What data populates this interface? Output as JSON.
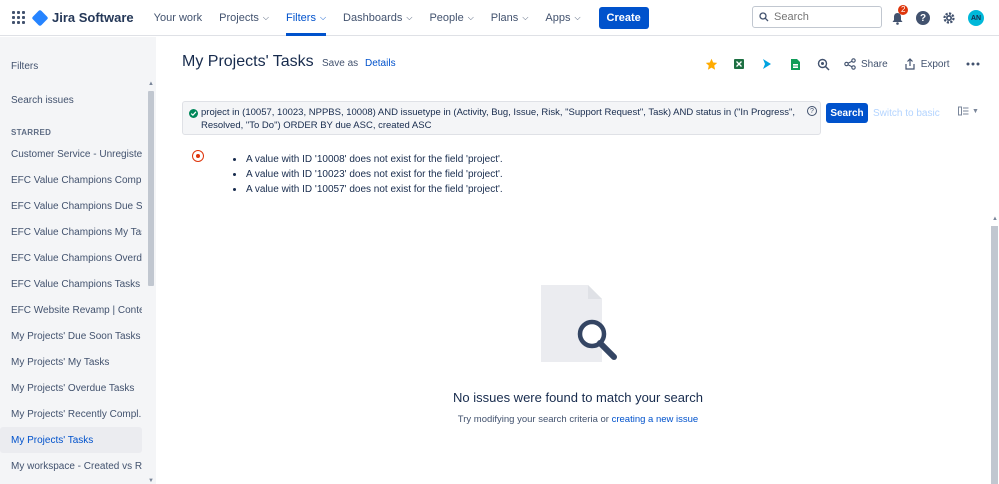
{
  "app": {
    "name": "Jira Software"
  },
  "nav": {
    "items": [
      {
        "label": "Your work",
        "dropdown": false,
        "active": false
      },
      {
        "label": "Projects",
        "dropdown": true,
        "active": false
      },
      {
        "label": "Filters",
        "dropdown": true,
        "active": true
      },
      {
        "label": "Dashboards",
        "dropdown": true,
        "active": false
      },
      {
        "label": "People",
        "dropdown": true,
        "active": false
      },
      {
        "label": "Plans",
        "dropdown": true,
        "active": false
      },
      {
        "label": "Apps",
        "dropdown": true,
        "active": false
      }
    ],
    "create_label": "Create",
    "search_placeholder": "Search",
    "notification_count": "2",
    "avatar_initials": "AN"
  },
  "sidebar": {
    "title": "Filters",
    "search_label": "Search issues",
    "starred_heading": "STARRED",
    "items": [
      {
        "label": "Customer Service - Unregiste...",
        "selected": false
      },
      {
        "label": "EFC Value Champions Compl...",
        "selected": false
      },
      {
        "label": "EFC Value Champions Due S...",
        "selected": false
      },
      {
        "label": "EFC Value Champions My Tas...",
        "selected": false
      },
      {
        "label": "EFC Value Champions Overd...",
        "selected": false
      },
      {
        "label": "EFC Value Champions Tasks",
        "selected": false
      },
      {
        "label": "EFC Website Revamp | Conte...",
        "selected": false
      },
      {
        "label": "My Projects' Due Soon Tasks",
        "selected": false
      },
      {
        "label": "My Projects' My Tasks",
        "selected": false
      },
      {
        "label": "My Projects' Overdue Tasks",
        "selected": false
      },
      {
        "label": "My Projects' Recently Compl...",
        "selected": false
      },
      {
        "label": "My Projects' Tasks",
        "selected": true
      },
      {
        "label": "My workspace - Created vs R...",
        "selected": false
      }
    ]
  },
  "main": {
    "title": "My Projects' Tasks",
    "save_as": "Save as",
    "details": "Details",
    "share_label": "Share",
    "export_label": "Export",
    "jql": "project in (10057, 10023, NPPBS, 10008) AND issuetype in (Activity, Bug, Issue, Risk, \"Support Request\", Task) AND status in (\"In Progress\", Resolved, \"To Do\") ORDER BY due ASC, created ASC",
    "search_button": "Search",
    "switch_basic": "Switch to basic",
    "errors": [
      "A value with ID '10008' does not exist for the field 'project'.",
      "A value with ID '10023' does not exist for the field 'project'.",
      "A value with ID '10057' does not exist for the field 'project'."
    ],
    "empty_title": "No issues were found to match your search",
    "empty_sub_prefix": "Try modifying your search criteria or",
    "empty_sub_link": "creating a new issue"
  },
  "colors": {
    "brand": "#0052cc",
    "error": "#de350b",
    "success": "#00875a",
    "star": "#ffab00"
  }
}
